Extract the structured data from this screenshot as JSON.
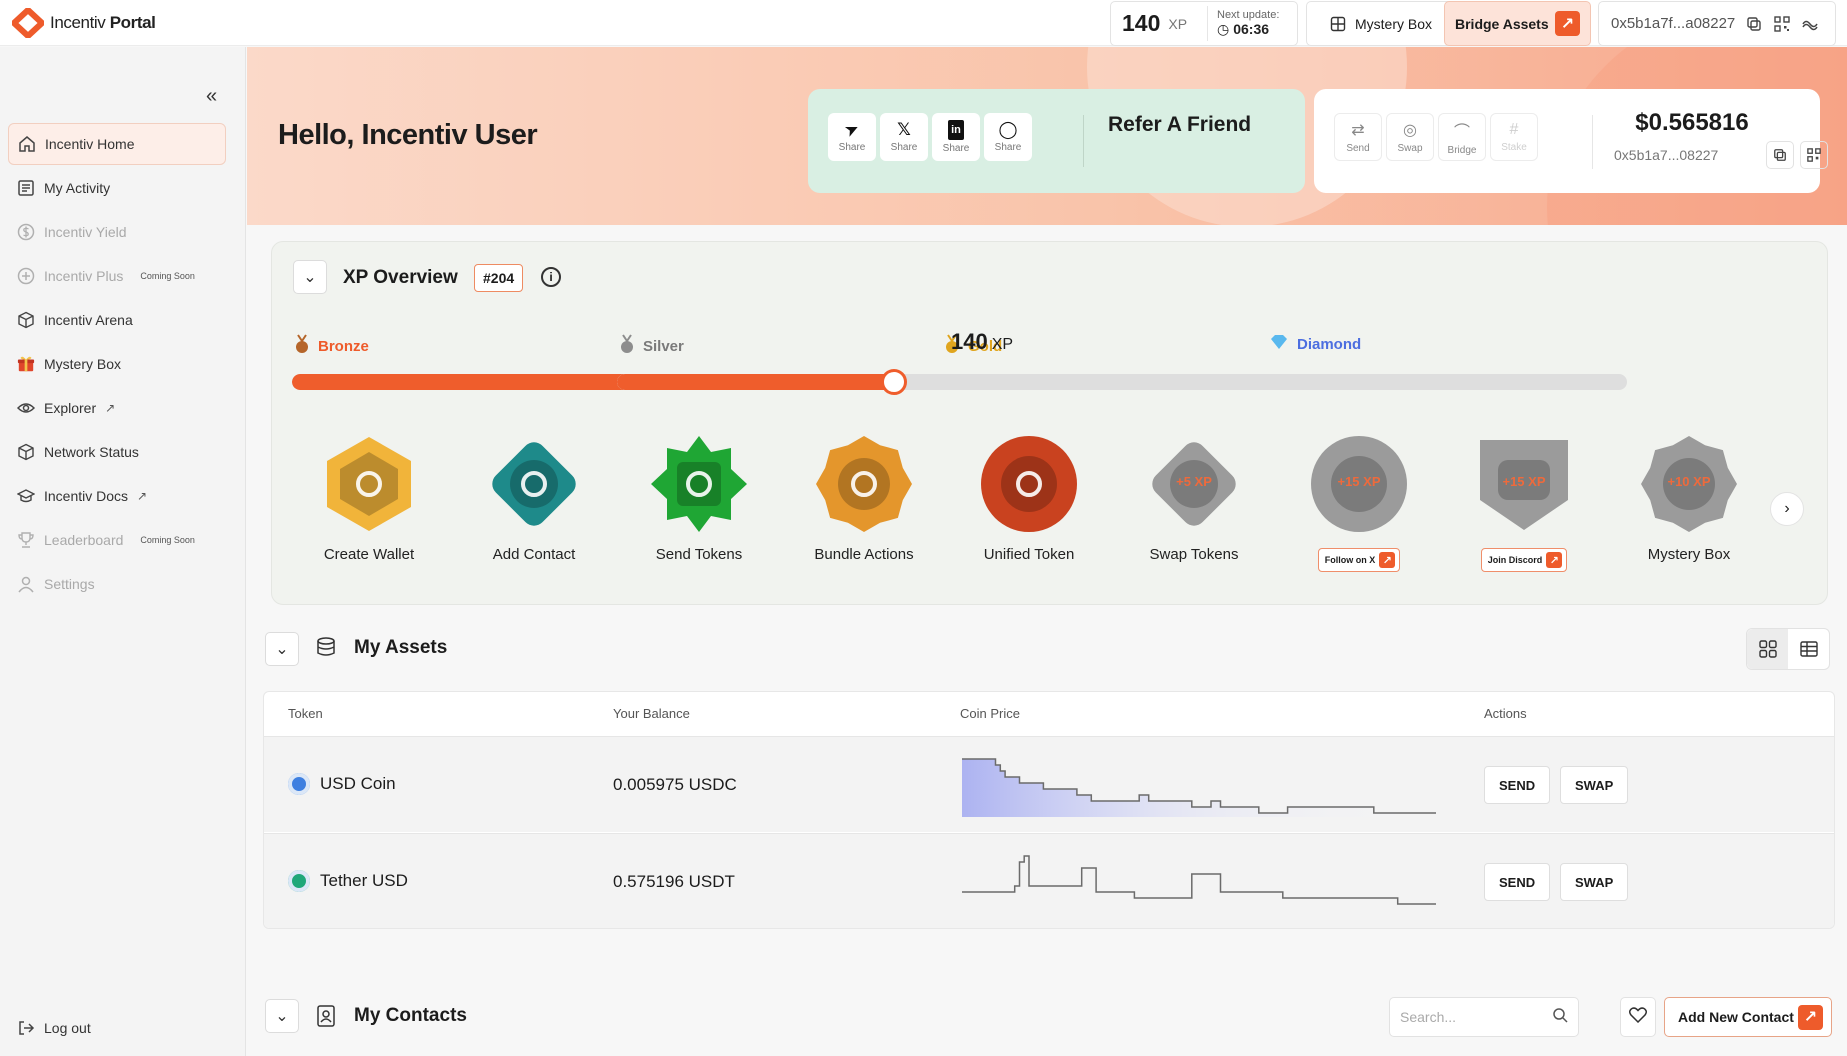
{
  "app": {
    "name_light": "Incentiv",
    "name_bold": "Portal"
  },
  "topbar": {
    "xp_value": "140",
    "xp_unit": "XP",
    "next_update_label": "Next update:",
    "next_update_time": "06:36",
    "mystery_box_label": "Mystery Box",
    "bridge_label": "Bridge Assets",
    "wallet_address": "0x5b1a7f...a08227"
  },
  "sidebar": {
    "items": [
      {
        "label": "Incentiv Home",
        "icon": "home-icon",
        "state": "active"
      },
      {
        "label": "My Activity",
        "icon": "activity-icon",
        "state": "normal"
      },
      {
        "label": "Incentiv Yield",
        "icon": "dollar-icon",
        "state": "disabled"
      },
      {
        "label": "Incentiv Plus",
        "icon": "plus-circle-icon",
        "state": "disabled",
        "badge": "Coming Soon"
      },
      {
        "label": "Incentiv Arena",
        "icon": "cube-icon",
        "state": "normal"
      },
      {
        "label": "Mystery Box",
        "icon": "gift-icon",
        "state": "normal"
      },
      {
        "label": "Explorer",
        "icon": "eye-icon",
        "state": "normal",
        "external": true
      },
      {
        "label": "Network Status",
        "icon": "network-icon",
        "state": "normal"
      },
      {
        "label": "Incentiv Docs",
        "icon": "docs-icon",
        "state": "normal",
        "external": true
      },
      {
        "label": "Leaderboard",
        "icon": "trophy-icon",
        "state": "disabled",
        "badge": "Coming Soon"
      },
      {
        "label": "Settings",
        "icon": "user-icon",
        "state": "disabled"
      }
    ],
    "logout_label": "Log out"
  },
  "hero": {
    "greeting": "Hello, Incentiv User",
    "share_buttons": [
      {
        "network": "telegram",
        "label": "Share"
      },
      {
        "network": "x",
        "label": "Share"
      },
      {
        "network": "linkedin",
        "label": "Share"
      },
      {
        "network": "whatsapp",
        "label": "Share"
      }
    ],
    "refer_label": "Refer A Friend",
    "wallet_actions": [
      {
        "label": "Send",
        "enabled": true
      },
      {
        "label": "Swap",
        "enabled": true
      },
      {
        "label": "Bridge",
        "enabled": true
      },
      {
        "label": "Stake",
        "enabled": false
      }
    ],
    "balance": "$0.565816",
    "address_short": "0x5b1a7...08227"
  },
  "xp_overview": {
    "title": "XP Overview",
    "rank": "#204",
    "current_xp": "140",
    "xp_unit": "XP",
    "tiers": [
      {
        "name": "Bronze",
        "color": "#ee5b2b",
        "progress": 1.0
      },
      {
        "name": "Silver",
        "color": "#7a7a7a",
        "progress": 0.77
      },
      {
        "name": "Gold",
        "color": "#e0a51e",
        "progress": 0
      },
      {
        "name": "Diamond",
        "color": "#4c6ee0",
        "progress": 0
      }
    ],
    "tasks": [
      {
        "label": "Create Wallet",
        "color": "#f1b43a",
        "shape": "hexagon",
        "done": true
      },
      {
        "label": "Add Contact",
        "color": "#1e8a8a",
        "shape": "diamond",
        "done": true
      },
      {
        "label": "Send Tokens",
        "color": "#1fa634",
        "shape": "star",
        "done": true
      },
      {
        "label": "Bundle Actions",
        "color": "#e4962c",
        "shape": "gear",
        "done": true
      },
      {
        "label": "Unified Token",
        "color": "#c9421f",
        "shape": "circle",
        "done": true
      },
      {
        "label": "Swap Tokens",
        "color": "#9b9b9b",
        "shape": "diamond",
        "done": false,
        "reward": "+5 XP"
      },
      {
        "label": "",
        "color": "#9b9b9b",
        "shape": "circle",
        "done": false,
        "reward": "+15 XP",
        "link": "Follow on X"
      },
      {
        "label": "",
        "color": "#9b9b9b",
        "shape": "shield",
        "done": false,
        "reward": "+15 XP",
        "link": "Join Discord"
      },
      {
        "label": "Mystery Box",
        "color": "#9b9b9b",
        "shape": "gear",
        "done": false,
        "reward": "+10 XP"
      }
    ]
  },
  "assets": {
    "title": "My Assets",
    "columns": [
      "Token",
      "Your Balance",
      "Coin Price",
      "Actions"
    ],
    "rows": [
      {
        "token": "USD Coin",
        "balance": "0.005975 USDC",
        "icon_color": "#3e7fe0",
        "send": "SEND",
        "swap": "SWAP",
        "price_series": [
          9,
          9,
          9,
          9,
          9,
          9,
          9,
          8,
          7,
          6,
          6,
          6,
          5,
          5,
          5,
          5,
          5,
          4,
          4,
          4,
          4,
          4,
          4,
          4,
          3,
          3,
          3,
          2,
          2,
          2,
          2,
          2,
          2,
          2,
          2,
          2,
          2,
          3,
          3,
          2,
          2,
          2,
          2,
          2,
          2,
          2,
          2,
          2,
          1,
          1,
          1,
          1,
          2,
          2,
          1,
          1,
          1,
          1,
          1,
          1,
          1,
          1,
          0,
          0,
          0,
          0,
          0,
          0,
          1,
          1,
          1,
          1,
          1,
          1,
          1,
          1,
          1,
          1,
          1,
          1,
          1,
          1,
          1,
          1,
          1,
          1,
          0,
          0,
          0,
          0,
          0,
          0,
          0,
          0,
          0,
          0,
          0,
          0,
          0,
          0
        ]
      },
      {
        "token": "Tether USD",
        "balance": "0.575196 USDT",
        "icon_color": "#1ea77a",
        "send": "SEND",
        "swap": "SWAP",
        "price_series": [
          3,
          3,
          3,
          3,
          3,
          3,
          3,
          3,
          3,
          3,
          3,
          4,
          8,
          9,
          4,
          4,
          4,
          4,
          4,
          4,
          4,
          4,
          4,
          4,
          4,
          7,
          7,
          7,
          3,
          3,
          3,
          3,
          3,
          3,
          3,
          3,
          2,
          2,
          2,
          2,
          2,
          2,
          2,
          2,
          2,
          2,
          2,
          2,
          6,
          6,
          6,
          6,
          6,
          6,
          3,
          3,
          3,
          3,
          3,
          3,
          3,
          3,
          3,
          3,
          3,
          3,
          3,
          2,
          2,
          2,
          2,
          2,
          2,
          2,
          2,
          2,
          2,
          2,
          2,
          2,
          2,
          2,
          2,
          2,
          2,
          2,
          2,
          2,
          2,
          2,
          2,
          1,
          1,
          1,
          1,
          1,
          1,
          1,
          1,
          1
        ]
      }
    ]
  },
  "contacts": {
    "title": "My Contacts",
    "search_placeholder": "Search...",
    "add_label": "Add New Contact"
  },
  "colors": {
    "accent": "#ee5b2b",
    "refer_bg": "#d9efe3"
  }
}
